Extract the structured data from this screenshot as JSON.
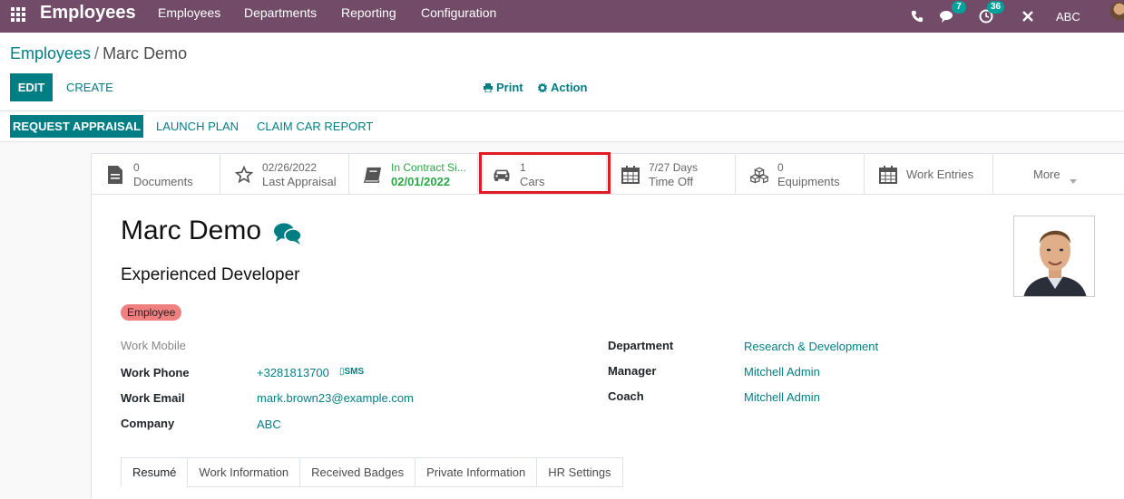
{
  "navbar": {
    "app_name": "Employees",
    "menus": [
      "Employees",
      "Departments",
      "Reporting",
      "Configuration"
    ],
    "messages_count": "7",
    "activities_count": "36",
    "company": "ABC"
  },
  "breadcrumb": {
    "parent": "Employees",
    "separator": "/",
    "current": "Marc Demo"
  },
  "control_panel": {
    "edit_label": "EDIT",
    "create_label": "CREATE",
    "print_label": "Print",
    "action_label": "Action"
  },
  "statusbar": {
    "request_appraisal_label": "REQUEST APPRAISAL",
    "launch_plan_label": "LAUNCH PLAN",
    "claim_car_report_label": "CLAIM CAR REPORT"
  },
  "smart_buttons": [
    {
      "value": "0",
      "label": "Documents",
      "icon": "document-icon"
    },
    {
      "value": "02/26/2022",
      "label": "Last Appraisal",
      "icon": "star-icon"
    },
    {
      "value": "In Contract Si...",
      "label": "02/01/2022",
      "icon": "book-icon"
    },
    {
      "value": "1",
      "label": "Cars",
      "icon": "car-icon"
    },
    {
      "value": "7/27 Days",
      "label": "Time Off",
      "icon": "calendar-icon"
    },
    {
      "value": "0",
      "label": "Equipments",
      "icon": "cubes-icon"
    },
    {
      "value": "",
      "label": "Work Entries",
      "icon": "calendar-icon"
    },
    {
      "value": "",
      "label": "More",
      "icon": "caret-down-icon"
    }
  ],
  "employee": {
    "name": "Marc Demo",
    "job_title": "Experienced Developer",
    "tag": "Employee"
  },
  "fields_left": {
    "work_mobile_label": "Work Mobile",
    "work_phone_label": "Work Phone",
    "work_phone_value": "+3281813700",
    "sms_label": "SMS",
    "work_email_label": "Work Email",
    "work_email_value": "mark.brown23@example.com",
    "company_label": "Company",
    "company_value": "ABC"
  },
  "fields_right": {
    "department_label": "Department",
    "department_value": "Research & Development",
    "manager_label": "Manager",
    "manager_value": "Mitchell Admin",
    "coach_label": "Coach",
    "coach_value": "Mitchell Admin"
  },
  "tabs": [
    "Resumé",
    "Work Information",
    "Received Badges",
    "Private Information",
    "HR Settings"
  ],
  "colors": {
    "navbar": "#714b67",
    "primary": "#017e84",
    "tag": "#f08080",
    "highlight": "#e01b24",
    "green": "#28a745"
  }
}
